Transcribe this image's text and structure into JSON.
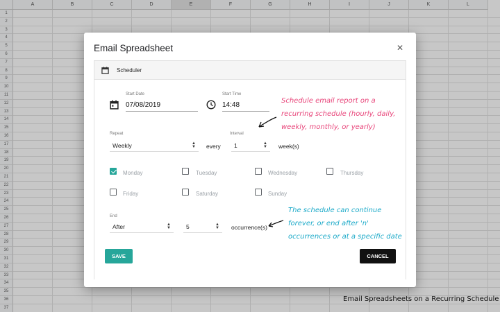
{
  "spreadsheet": {
    "columns": [
      "A",
      "B",
      "C",
      "D",
      "E",
      "F",
      "G",
      "H",
      "I",
      "J",
      "K",
      "L"
    ],
    "selected_column": "E",
    "rows": [
      "1",
      "2",
      "3",
      "4",
      "5",
      "6",
      "7",
      "8",
      "9",
      "10",
      "11",
      "12",
      "13",
      "14",
      "15",
      "16",
      "17",
      "18",
      "19",
      "20",
      "21",
      "22",
      "23",
      "24",
      "25",
      "26",
      "27",
      "28",
      "29",
      "30",
      "31",
      "32",
      "33",
      "34",
      "35",
      "36",
      "37"
    ]
  },
  "dialog": {
    "title": "Email Spreadsheet",
    "close_icon": "close-icon",
    "section_title": "Scheduler",
    "section_icon": "calendar-icon",
    "start_date_label": "Start Date",
    "start_date_value": "07/08/2019",
    "start_time_label": "Start Time",
    "start_time_value": "14:48",
    "repeat_label": "Repeat",
    "repeat_value": "Weekly",
    "every_text": "every",
    "interval_label": "Interval",
    "interval_value": "1",
    "interval_unit": "week(s)",
    "days": [
      {
        "label": "Monday",
        "checked": true
      },
      {
        "label": "Tuesday",
        "checked": false
      },
      {
        "label": "Wednesday",
        "checked": false
      },
      {
        "label": "Thursday",
        "checked": false
      },
      {
        "label": "Friday",
        "checked": false
      },
      {
        "label": "Saturday",
        "checked": false
      },
      {
        "label": "Sunday",
        "checked": false
      }
    ],
    "end_label": "End",
    "end_value": "After",
    "occurrences_value": "5",
    "occurrences_text": "occurrence(s)",
    "save_label": "SAVE",
    "cancel_label": "CANCEL"
  },
  "annotations": {
    "schedule_note": "Schedule email report on a recurring schedule (hourly, daily, weekly, monthly, or yearly)",
    "end_note": "The schedule can continue forever, or end after 'n' occurrences or at a specific date",
    "caption": "Email Spreadsheets on a Recurring Schedule"
  },
  "colors": {
    "accent": "#26a69a",
    "pink_annotation": "#e8457a",
    "cyan_annotation": "#1aa9c8"
  }
}
